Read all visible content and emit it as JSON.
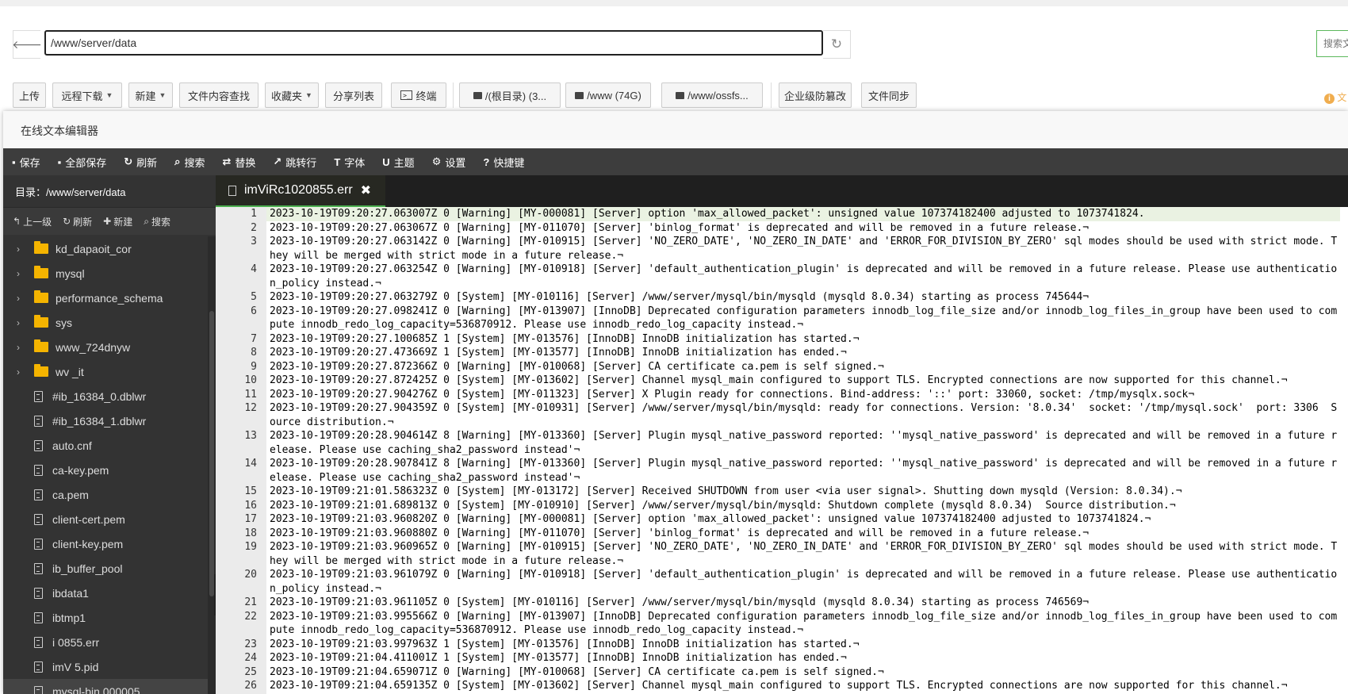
{
  "address": {
    "path": "/www/server/data",
    "search_placeholder": "搜索文"
  },
  "toolbar": {
    "upload": "上传",
    "remote_download": "远程下载",
    "new": "新建",
    "content_search": "文件内容查找",
    "favorites": "收藏夹",
    "share_list": "分享列表",
    "terminal": "终端",
    "disk_root": "/(根目录) (3...",
    "disk_www": "/www (74G)",
    "disk_oss": "/www/ossfs...",
    "enterprise": "企业级防篡改",
    "file_sync": "文件同步",
    "info_text": "文"
  },
  "editor": {
    "title": "在线文本编辑器",
    "tools": [
      {
        "icon": "save-icon",
        "glyph": "▪",
        "label": "保存"
      },
      {
        "icon": "save-all-icon",
        "glyph": "▪",
        "label": "全部保存"
      },
      {
        "icon": "refresh-icon",
        "glyph": "↻",
        "label": "刷新"
      },
      {
        "icon": "search-icon",
        "glyph": "⌕",
        "label": "搜索"
      },
      {
        "icon": "replace-icon",
        "glyph": "⇄",
        "label": "替换"
      },
      {
        "icon": "goto-line-icon",
        "glyph": "↗",
        "label": "跳转行"
      },
      {
        "icon": "font-icon",
        "glyph": "T",
        "label": "字体"
      },
      {
        "icon": "theme-icon",
        "glyph": "U",
        "label": "主题"
      },
      {
        "icon": "settings-icon",
        "glyph": "⚙",
        "label": "设置"
      },
      {
        "icon": "help-icon",
        "glyph": "?",
        "label": "快捷键"
      }
    ],
    "sidebar": {
      "dir_label": "目录：/www/server/data",
      "actions": {
        "up": "上一级",
        "refresh": "刷新",
        "new": "新建",
        "search": "搜索"
      },
      "items": [
        {
          "type": "folder",
          "name": "kd_dapaoit_cor"
        },
        {
          "type": "folder",
          "name": "mysql"
        },
        {
          "type": "folder",
          "name": "performance_schema"
        },
        {
          "type": "folder",
          "name": "sys"
        },
        {
          "type": "folder",
          "name": "www_724dnyw"
        },
        {
          "type": "folder",
          "name": "wv    _it"
        },
        {
          "type": "file",
          "name": "#ib_16384_0.dblwr"
        },
        {
          "type": "file",
          "name": "#ib_16384_1.dblwr"
        },
        {
          "type": "file",
          "name": "auto.cnf"
        },
        {
          "type": "file",
          "name": "ca-key.pem"
        },
        {
          "type": "file",
          "name": "ca.pem"
        },
        {
          "type": "file",
          "name": "client-cert.pem"
        },
        {
          "type": "file",
          "name": "client-key.pem"
        },
        {
          "type": "file",
          "name": "ib_buffer_pool"
        },
        {
          "type": "file",
          "name": "ibdata1"
        },
        {
          "type": "file",
          "name": "ibtmp1"
        },
        {
          "type": "file",
          "name": "i      0855.err"
        },
        {
          "type": "file",
          "name": "imV        5.pid"
        },
        {
          "type": "file",
          "name": "mysql-bin.000005"
        }
      ]
    },
    "tab": {
      "filename": "imViRc1020855.err"
    },
    "lines": [
      {
        "n": "1",
        "text": "2023-10-19T09:20:27.063007Z 0 [Warning] [MY-000081] [Server] option 'max_allowed_packet': unsigned value 107374182400 adjusted to 1073741824."
      },
      {
        "n": "2",
        "text": "2023-10-19T09:20:27.063067Z 0 [Warning] [MY-011070] [Server] 'binlog_format' is deprecated and will be removed in a future release.¬"
      },
      {
        "n": "3",
        "text": "2023-10-19T09:20:27.063142Z 0 [Warning] [MY-010915] [Server] 'NO_ZERO_DATE', 'NO_ZERO_IN_DATE' and 'ERROR_FOR_DIVISION_BY_ZERO' sql modes should be used with strict mode. They will be merged with strict mode in a future release.¬"
      },
      {
        "n": "4",
        "text": "2023-10-19T09:20:27.063254Z 0 [Warning] [MY-010918] [Server] 'default_authentication_plugin' is deprecated and will be removed in a future release. Please use authentication_policy instead.¬"
      },
      {
        "n": "5",
        "text": "2023-10-19T09:20:27.063279Z 0 [System] [MY-010116] [Server] /www/server/mysql/bin/mysqld (mysqld 8.0.34) starting as process 745644¬"
      },
      {
        "n": "6",
        "text": "2023-10-19T09:20:27.098241Z 0 [Warning] [MY-013907] [InnoDB] Deprecated configuration parameters innodb_log_file_size and/or innodb_log_files_in_group have been used to compute innodb_redo_log_capacity=536870912. Please use innodb_redo_log_capacity instead.¬"
      },
      {
        "n": "7",
        "text": "2023-10-19T09:20:27.100685Z 1 [System] [MY-013576] [InnoDB] InnoDB initialization has started.¬"
      },
      {
        "n": "8",
        "text": "2023-10-19T09:20:27.473669Z 1 [System] [MY-013577] [InnoDB] InnoDB initialization has ended.¬"
      },
      {
        "n": "9",
        "text": "2023-10-19T09:20:27.872366Z 0 [Warning] [MY-010068] [Server] CA certificate ca.pem is self signed.¬"
      },
      {
        "n": "10",
        "text": "2023-10-19T09:20:27.872425Z 0 [System] [MY-013602] [Server] Channel mysql_main configured to support TLS. Encrypted connections are now supported for this channel.¬"
      },
      {
        "n": "11",
        "text": "2023-10-19T09:20:27.904276Z 0 [System] [MY-011323] [Server] X Plugin ready for connections. Bind-address: '::' port: 33060, socket: /tmp/mysqlx.sock¬"
      },
      {
        "n": "12",
        "text": "2023-10-19T09:20:27.904359Z 0 [System] [MY-010931] [Server] /www/server/mysql/bin/mysqld: ready for connections. Version: '8.0.34'  socket: '/tmp/mysql.sock'  port: 3306  Source distribution.¬"
      },
      {
        "n": "13",
        "text": "2023-10-19T09:20:28.904614Z 8 [Warning] [MY-013360] [Server] Plugin mysql_native_password reported: ''mysql_native_password' is deprecated and will be removed in a future release. Please use caching_sha2_password instead'¬"
      },
      {
        "n": "14",
        "text": "2023-10-19T09:20:28.907841Z 8 [Warning] [MY-013360] [Server] Plugin mysql_native_password reported: ''mysql_native_password' is deprecated and will be removed in a future release. Please use caching_sha2_password instead'¬"
      },
      {
        "n": "15",
        "text": "2023-10-19T09:21:01.586323Z 0 [System] [MY-013172] [Server] Received SHUTDOWN from user <via user signal>. Shutting down mysqld (Version: 8.0.34).¬"
      },
      {
        "n": "16",
        "text": "2023-10-19T09:21:01.689813Z 0 [System] [MY-010910] [Server] /www/server/mysql/bin/mysqld: Shutdown complete (mysqld 8.0.34)  Source distribution.¬"
      },
      {
        "n": "17",
        "text": "2023-10-19T09:21:03.960820Z 0 [Warning] [MY-000081] [Server] option 'max_allowed_packet': unsigned value 107374182400 adjusted to 1073741824.¬"
      },
      {
        "n": "18",
        "text": "2023-10-19T09:21:03.960880Z 0 [Warning] [MY-011070] [Server] 'binlog_format' is deprecated and will be removed in a future release.¬"
      },
      {
        "n": "19",
        "text": "2023-10-19T09:21:03.960965Z 0 [Warning] [MY-010915] [Server] 'NO_ZERO_DATE', 'NO_ZERO_IN_DATE' and 'ERROR_FOR_DIVISION_BY_ZERO' sql modes should be used with strict mode. They will be merged with strict mode in a future release.¬"
      },
      {
        "n": "20",
        "text": "2023-10-19T09:21:03.961079Z 0 [Warning] [MY-010918] [Server] 'default_authentication_plugin' is deprecated and will be removed in a future release. Please use authentication_policy instead.¬"
      },
      {
        "n": "21",
        "text": "2023-10-19T09:21:03.961105Z 0 [System] [MY-010116] [Server] /www/server/mysql/bin/mysqld (mysqld 8.0.34) starting as process 746569¬"
      },
      {
        "n": "22",
        "text": "2023-10-19T09:21:03.995566Z 0 [Warning] [MY-013907] [InnoDB] Deprecated configuration parameters innodb_log_file_size and/or innodb_log_files_in_group have been used to compute innodb_redo_log_capacity=536870912. Please use innodb_redo_log_capacity instead.¬"
      },
      {
        "n": "23",
        "text": "2023-10-19T09:21:03.997963Z 1 [System] [MY-013576] [InnoDB] InnoDB initialization has started.¬"
      },
      {
        "n": "24",
        "text": "2023-10-19T09:21:04.411001Z 1 [System] [MY-013577] [InnoDB] InnoDB initialization has ended.¬"
      },
      {
        "n": "25",
        "text": "2023-10-19T09:21:04.659071Z 0 [Warning] [MY-010068] [Server] CA certificate ca.pem is self signed.¬"
      },
      {
        "n": "26",
        "text": "2023-10-19T09:21:04.659135Z 0 [System] [MY-013602] [Server] Channel mysql_main configured to support TLS. Encrypted connections are now supported for this channel.¬"
      }
    ]
  }
}
